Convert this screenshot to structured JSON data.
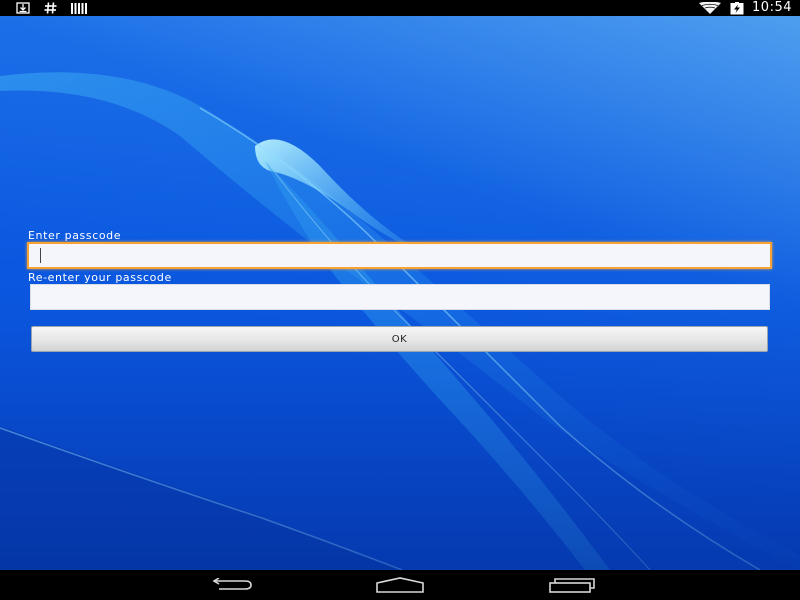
{
  "status_bar": {
    "left_icons": [
      "download-icon",
      "hash-icon",
      "barcode-icon"
    ],
    "right_icons": [
      "wifi-icon",
      "battery-charging-icon"
    ],
    "time": "10:54"
  },
  "form": {
    "passcode_label": "Enter passcode",
    "passcode_value": "",
    "confirm_label": "Re-enter your passcode",
    "confirm_value": "",
    "ok_label": "OK",
    "focus_color": "#f7a233"
  },
  "nav_bar": {
    "icons": [
      "back-icon",
      "home-icon",
      "recents-icon"
    ]
  }
}
